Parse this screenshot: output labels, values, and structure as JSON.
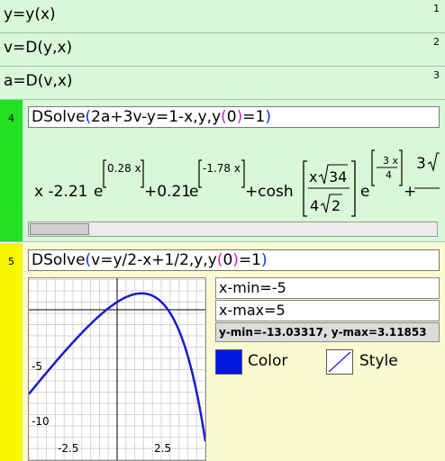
{
  "definitions": [
    {
      "expr": "y=y(x)",
      "num": "1"
    },
    {
      "expr": "v=D(y,x)",
      "num": "2"
    },
    {
      "expr": "a=D(v,x)",
      "num": "3"
    }
  ],
  "cell4": {
    "num": "4",
    "input": {
      "func": "DSolve",
      "args_a": "2a+3v-y=1-x,y,y",
      "args_b": "0",
      "args_c": "=1"
    },
    "result": {
      "t1": "x -2.21",
      "e": "e",
      "exp1": "0.28 x",
      "t2": "+0.21",
      "exp2": "-1.78 x",
      "t3": "+cosh",
      "frac_num": "x",
      "sqrt_num": "34",
      "frac_den": "4",
      "sqrt_den": "2",
      "exp3_num": "3 x",
      "exp3_den": "4",
      "tail": "+",
      "tail_num": "3"
    }
  },
  "cell5": {
    "num": "5",
    "input": {
      "func": "DSolve",
      "args_a": "v=y/2-x+1/2,y,y",
      "args_b": "0",
      "args_c": "=1"
    },
    "xmin": "x-min=-5",
    "xmax": "x-max=5",
    "yrange": "y-min=-13.03317, y-max=3.11853",
    "color_label": "Color",
    "style_label": "Style",
    "colors": {
      "curve": "#1a1acc",
      "swatch": "#0018e0"
    },
    "ticks": {
      "x_neg": "-2.5",
      "x_pos": "2.5",
      "y1": "-5",
      "y2": "-10"
    }
  }
}
